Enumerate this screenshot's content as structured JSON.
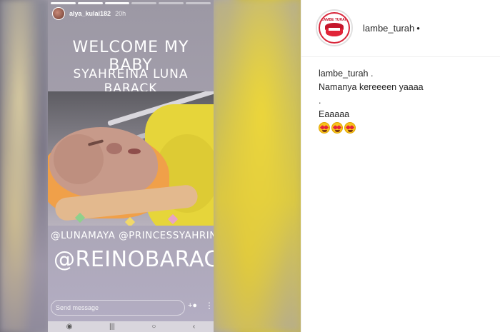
{
  "story": {
    "username": "alya_kulai182",
    "time": "20h",
    "headline_line1": "WELCOME MY BABY",
    "headline_line2": "SYAHREINA LUNA BARACK",
    "mentions_line1": "@LUNAMAYA @PRINCESSYAHRINI",
    "mentions_line2": "@REINOBARACK",
    "reply_placeholder": "Send message",
    "add_icon": "add-person-icon",
    "more_icon": "more-vertical-icon",
    "progress_segments": 6,
    "progress_done": 3
  },
  "navbar": {
    "items": [
      "◉",
      "|||",
      "○",
      "‹"
    ]
  },
  "post": {
    "username": "lambe_turah",
    "separator": "•",
    "avatar_text": "LAMBE TURAH",
    "caption": {
      "author": "lambe_turah .",
      "line1": "Namanya kereeeen yaaaa",
      "line2": ".",
      "line3": "Eaaaaa"
    },
    "emoji_name": "heart-eyes-emoji",
    "emoji_count": 3
  }
}
